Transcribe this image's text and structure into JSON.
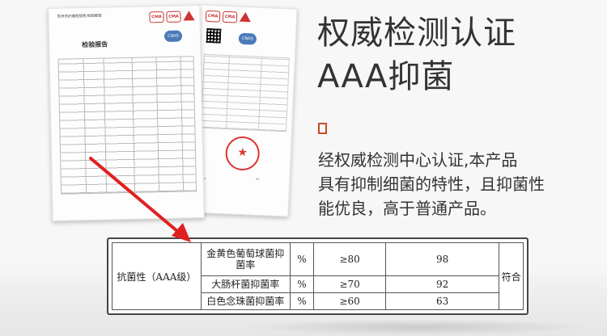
{
  "heading": {
    "line1": "权威检测认证",
    "line2": "AAA抑菌"
  },
  "description": [
    "经权威检测中心认证,本产品",
    "具有抑制细菌的特性，且抑菌性",
    "能优良，高于普通产品。"
  ],
  "report": {
    "title": "检验报告",
    "header_text": "苏州市纤维检验院 检验报告",
    "stamp_char": "★"
  },
  "results_table": {
    "category": "抗菌性（AAA级）",
    "conclusion": "符合",
    "rows": [
      {
        "item": "金黄色葡萄球菌抑菌率",
        "unit": "%",
        "standard": "≥80",
        "value": "98"
      },
      {
        "item": "大肠杆菌抑菌率",
        "unit": "%",
        "standard": "≥70",
        "value": "92"
      },
      {
        "item": "白色念珠菌抑菌率",
        "unit": "%",
        "standard": "≥60",
        "value": "63"
      }
    ]
  },
  "colors": {
    "accent": "#c64a2a",
    "arrow": "#e02020",
    "text": "#333333"
  }
}
